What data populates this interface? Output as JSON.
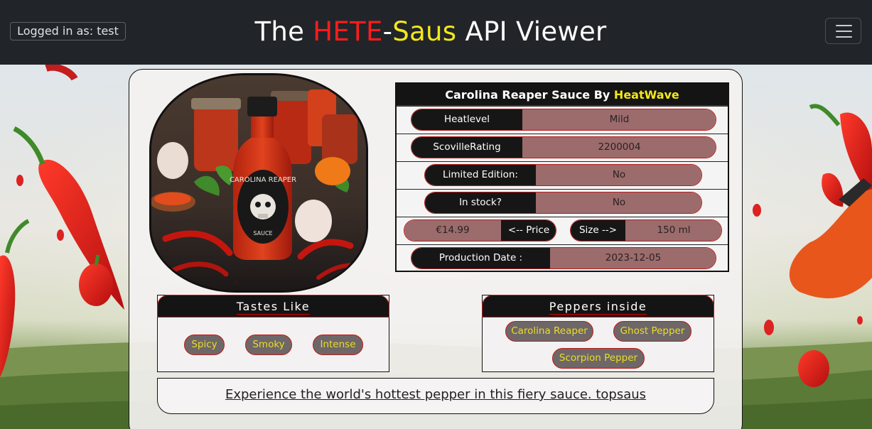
{
  "navbar": {
    "login": "Logged in as: test",
    "title_part1": "The ",
    "title_part2": "HETE",
    "title_part3": "-",
    "title_part4": "Saus",
    "title_part5": " API Viewer"
  },
  "product": {
    "name": "Carolina Reaper Sauce By",
    "brand": "HeatWave",
    "bottle_label_line1": "CAROLINA REAPER",
    "bottle_label_line2": "SAUCE",
    "heatlevel_label": "Heatlevel",
    "heatlevel_value": "Mild",
    "scoville_label": "ScovilleRating",
    "scoville_value": "2200004",
    "limited_label": "Limited Edition:",
    "limited_value": "No",
    "stock_label": "In stock?",
    "stock_value": "No",
    "price_value": "€14.99",
    "price_label": "<-- Price",
    "size_label": "Size -->",
    "size_value": "150 ml",
    "date_label": "Production Date :",
    "date_value": "2023-12-05"
  },
  "tastes": {
    "title": "Tastes Like",
    "items": [
      "Spicy",
      "Smoky",
      "Intense"
    ]
  },
  "peppers": {
    "title": "Peppers inside",
    "items": [
      "Carolina Reaper",
      "Ghost Pepper",
      "Scorpion Pepper"
    ]
  },
  "description": "Experience the world's hottest pepper in this fiery sauce. topsaus",
  "colors": {
    "navbar_bg": "#212529",
    "accent_red": "#ff1c1c",
    "accent_yellow": "#f3e81a",
    "pill_value_bg": "#9c6b6c",
    "chip_bg": "#6f6767"
  }
}
